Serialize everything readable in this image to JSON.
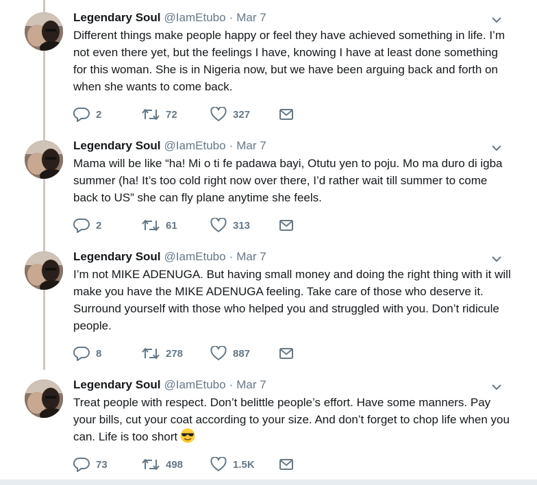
{
  "tweets": [
    {
      "name": "Legendary Soul",
      "handle": "@IamEtubo",
      "sep": "·",
      "date": "Mar 7",
      "text": "Different things make people happy or feel they have achieved something in life. I’m not even there yet, but the feelings I have, knowing I have at least done something for this woman. She is in Nigeria now, but we have been arguing back and forth on when she wants to come back.",
      "replies": "2",
      "retweets": "72",
      "likes": "327"
    },
    {
      "name": "Legendary Soul",
      "handle": "@IamEtubo",
      "sep": "·",
      "date": "Mar 7",
      "text": "Mama will be like “ha! Mi o ti fe padawa bayi, Otutu yen to poju. Mo ma duro di igba summer (ha! It’s too cold right now over there, I’d rather wait till summer to come back to US” she can fly plane anytime she feels.",
      "replies": "2",
      "retweets": "61",
      "likes": "313"
    },
    {
      "name": "Legendary Soul",
      "handle": "@IamEtubo",
      "sep": "·",
      "date": "Mar 7",
      "text": "I’m not MIKE ADENUGA. But having small money and doing the right thing with it will make you have the MIKE ADENUGA feeling. Take care of those who deserve it. Surround yourself with those who helped you and struggled with you. Don’t ridicule people.",
      "replies": "8",
      "retweets": "278",
      "likes": "887"
    },
    {
      "name": "Legendary Soul",
      "handle": "@IamEtubo",
      "sep": "·",
      "date": "Mar 7",
      "text": "Treat people with respect. Don’t belittle people’s effort. Have some manners. Pay your bills, cut your coat according to your size. And don’t forget to chop life when you can. Life is too short",
      "emoji": "smiling-face-with-sunglasses",
      "replies": "73",
      "retweets": "498",
      "likes": "1.5K"
    }
  ],
  "icons": {
    "reply": "reply-icon",
    "retweet": "retweet-icon",
    "like": "heart-icon",
    "dm": "envelope-icon",
    "menu": "chevron-down-icon"
  },
  "colors": {
    "text": "#14171a",
    "secondary": "#657786",
    "thread_line": "#d6c3bf",
    "divider": "#e6ecf0"
  }
}
